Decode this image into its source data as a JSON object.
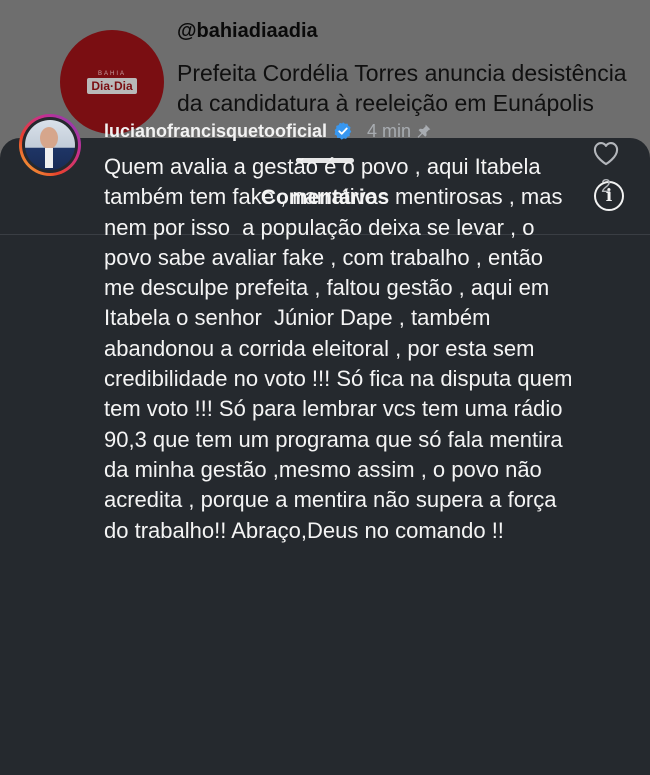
{
  "post": {
    "avatar_logo_small": "BAHIA",
    "avatar_logo_main": "Dia·Dia",
    "handle": "@bahiadiaadia",
    "headline": "Prefeita Cordélia Torres anuncia desistência da candidatura à reeleição em Eunápolis"
  },
  "sheet": {
    "title": "Comentários",
    "info_icon": "info-icon"
  },
  "comment": {
    "username": "lucianofrancisquetooficial",
    "verified_icon": "verified-badge-icon",
    "time": "4 min",
    "pin_icon": "pin-icon",
    "text": "Quem avalia a gestão é o povo , aqui Itabela também tem fake , narrativas mentirosas , mas nem por isso  a população deixa se levar , o povo sabe avaliar fake , com trabalho , então me desculpe prefeita , faltou gestão , aqui em Itabela o senhor  Júnior Dape , também abandonou a corrida eleitoral , por esta sem credibilidade no voto !!! Só fica na disputa quem tem voto !!! Só para lembrar vcs tem uma rádio  90,3 que tem um programa que só fala mentira da minha gestão ,mesmo assim , o povo não acredita , porque a mentira não supera a força do trabalho!! Abraço,Deus no comando !!",
    "like_icon": "heart-icon",
    "like_count": "2"
  },
  "colors": {
    "sheet_bg": "#25292e",
    "verified_blue": "#3897f0",
    "brand_red": "#7a0e12"
  }
}
